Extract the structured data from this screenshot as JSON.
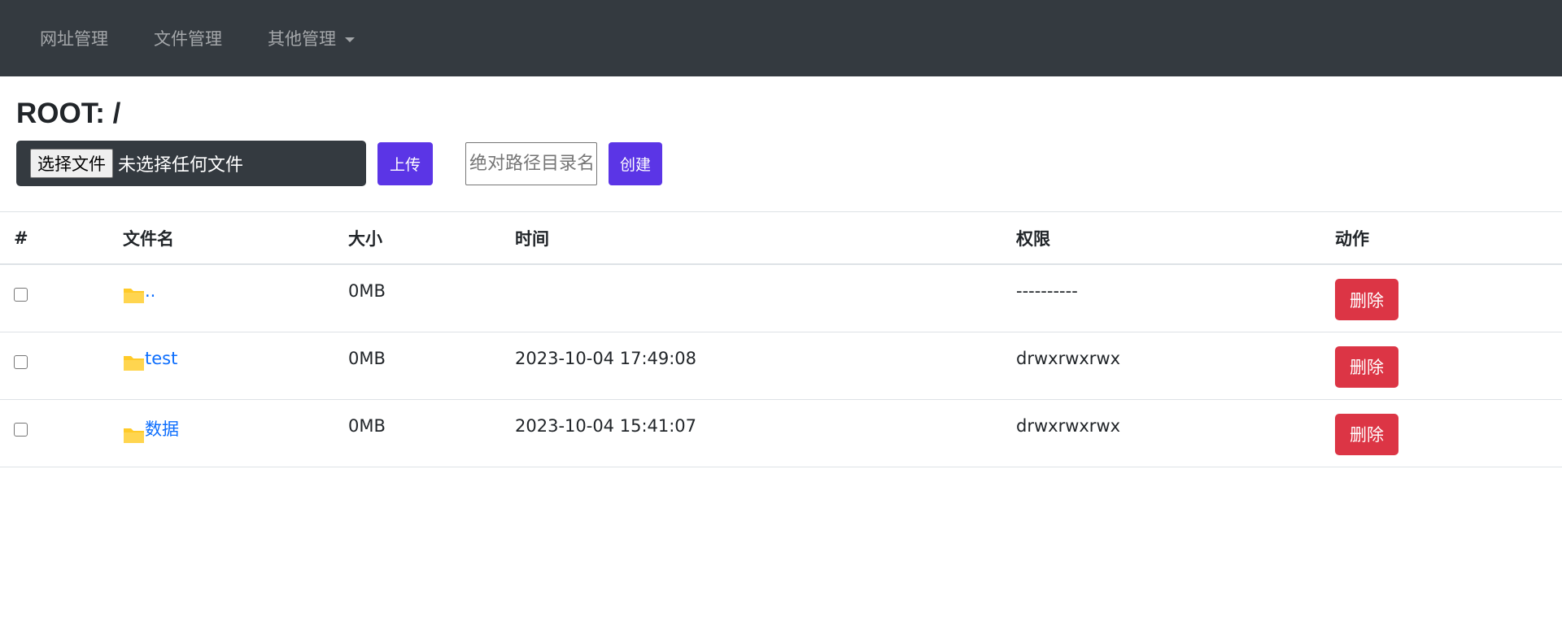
{
  "nav": {
    "items": [
      {
        "label": "网址管理"
      },
      {
        "label": "文件管理"
      },
      {
        "label": "其他管理"
      }
    ]
  },
  "page": {
    "title": "ROOT: /"
  },
  "upload": {
    "choose_label": "选择文件",
    "status": "未选择任何文件",
    "button": "上传"
  },
  "create": {
    "placeholder": "绝对路径目录名",
    "button": "创建"
  },
  "table": {
    "headers": [
      "#",
      "文件名",
      "大小",
      "时间",
      "权限",
      "动作"
    ],
    "rows": [
      {
        "name": "..",
        "size": "0MB",
        "time": "",
        "perm": "----------",
        "action": "删除"
      },
      {
        "name": "test",
        "size": "0MB",
        "time": "2023-10-04 17:49:08",
        "perm": "drwxrwxrwx",
        "action": "删除"
      },
      {
        "name": "数据",
        "size": "0MB",
        "time": "2023-10-04 15:41:07",
        "perm": "drwxrwxrwx",
        "action": "删除"
      }
    ]
  },
  "colors": {
    "navbar": "#343a40",
    "primary": "#5b35e6",
    "danger": "#dc3545",
    "link": "#0d6efd",
    "folder": "#ffca28"
  },
  "icons": {
    "folder": "folder-icon",
    "dropdown": "caret-down-icon"
  }
}
